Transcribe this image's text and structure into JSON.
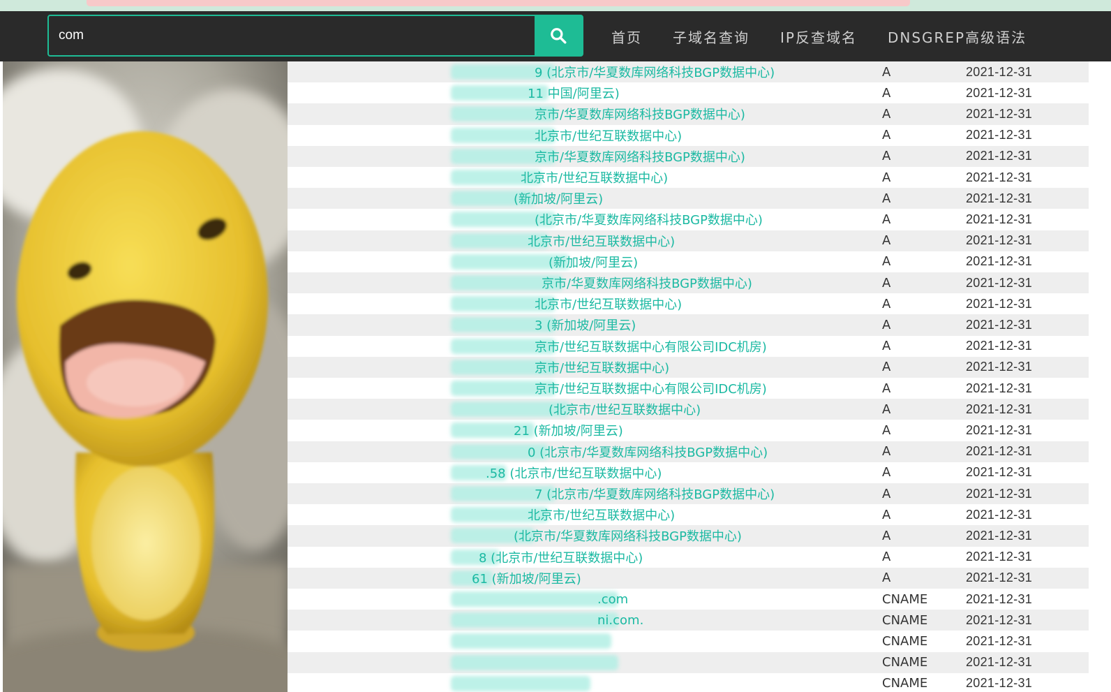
{
  "search": {
    "value": "com",
    "button_icon": "search-icon"
  },
  "nav": {
    "items": [
      {
        "label": "首页"
      },
      {
        "label": "子域名查询"
      },
      {
        "label": "IP反查域名"
      },
      {
        "label": "DNSGREP高级语法"
      }
    ]
  },
  "colors": {
    "accent": "#1ebc95",
    "link": "#1bb9a2",
    "navbar": "#2a2a2a",
    "stripe": "#eeeeee"
  },
  "records": [
    {
      "ip": "9 (北京市/华夏数库网络科技BGP数据中心)",
      "type": "A",
      "date": "2021-12-31"
    },
    {
      "ip": "11 中国/阿里云)",
      "type": "A",
      "date": "2021-12-31"
    },
    {
      "ip": "京市/华夏数库网络科技BGP数据中心)",
      "type": "A",
      "date": "2021-12-31"
    },
    {
      "ip": "北京市/世纪互联数据中心)",
      "type": "A",
      "date": "2021-12-31"
    },
    {
      "ip": "京市/华夏数库网络科技BGP数据中心)",
      "type": "A",
      "date": "2021-12-31"
    },
    {
      "ip": "北京市/世纪互联数据中心)",
      "type": "A",
      "date": "2021-12-31"
    },
    {
      "ip": "(新加坡/阿里云)",
      "type": "A",
      "date": "2021-12-31"
    },
    {
      "ip": "(北京市/华夏数库网络科技BGP数据中心)",
      "type": "A",
      "date": "2021-12-31"
    },
    {
      "ip": "北京市/世纪互联数据中心)",
      "type": "A",
      "date": "2021-12-31"
    },
    {
      "ip": "(新加坡/阿里云)",
      "type": "A",
      "date": "2021-12-31"
    },
    {
      "ip": "京市/华夏数库网络科技BGP数据中心)",
      "type": "A",
      "date": "2021-12-31"
    },
    {
      "ip": "北京市/世纪互联数据中心)",
      "type": "A",
      "date": "2021-12-31"
    },
    {
      "ip": "3 (新加坡/阿里云)",
      "type": "A",
      "date": "2021-12-31"
    },
    {
      "ip": "京市/世纪互联数据中心有限公司IDC机房)",
      "type": "A",
      "date": "2021-12-31"
    },
    {
      "ip": "京市/世纪互联数据中心)",
      "type": "A",
      "date": "2021-12-31"
    },
    {
      "ip": "京市/世纪互联数据中心有限公司IDC机房)",
      "type": "A",
      "date": "2021-12-31"
    },
    {
      "ip": "(北京市/世纪互联数据中心)",
      "type": "A",
      "date": "2021-12-31"
    },
    {
      "ip": "21 (新加坡/阿里云)",
      "type": "A",
      "date": "2021-12-31"
    },
    {
      "ip": "0 (北京市/华夏数库网络科技BGP数据中心)",
      "type": "A",
      "date": "2021-12-31"
    },
    {
      "ip": ".58 (北京市/世纪互联数据中心)",
      "type": "A",
      "date": "2021-12-31"
    },
    {
      "ip": "7 (北京市/华夏数库网络科技BGP数据中心)",
      "type": "A",
      "date": "2021-12-31"
    },
    {
      "ip": "北京市/世纪互联数据中心)",
      "type": "A",
      "date": "2021-12-31"
    },
    {
      "ip": "(北京市/华夏数库网络科技BGP数据中心)",
      "type": "A",
      "date": "2021-12-31"
    },
    {
      "ip": "8 (北京市/世纪互联数据中心)",
      "type": "A",
      "date": "2021-12-31"
    },
    {
      "ip": "61 (新加坡/阿里云)",
      "type": "A",
      "date": "2021-12-31"
    },
    {
      "ip": ".com",
      "type": "CNAME",
      "date": "2021-12-31"
    },
    {
      "ip": "ni.com.",
      "type": "CNAME",
      "date": "2021-12-31"
    },
    {
      "ip": "",
      "type": "CNAME",
      "date": "2021-12-31"
    },
    {
      "ip": "",
      "type": "CNAME",
      "date": "2021-12-31"
    },
    {
      "ip": "",
      "type": "CNAME",
      "date": "2021-12-31"
    }
  ]
}
